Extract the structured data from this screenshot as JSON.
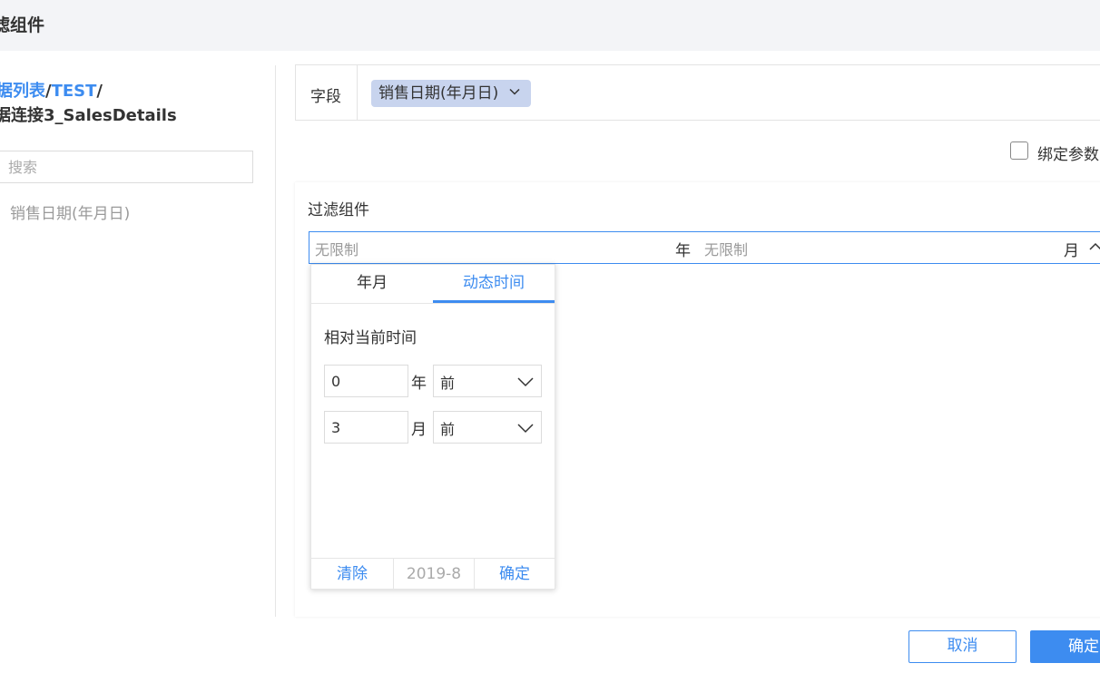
{
  "header": {
    "title": "滤组件"
  },
  "left_pane": {
    "breadcrumb": {
      "part1": "据列表",
      "sep1": "/",
      "part2": "TEST",
      "sep2": "/",
      "line2": "据连接3_SalesDetails"
    },
    "search": {
      "placeholder": "搜索",
      "value": ""
    },
    "fields": [
      "销售日期(年月日)"
    ]
  },
  "field_row": {
    "label": "字段",
    "tag": "销售日期(年月日)"
  },
  "bind_param": {
    "label": "绑定参数",
    "checked": false
  },
  "preview": {
    "title": "过滤组件",
    "range": {
      "start_placeholder": "无限制",
      "start_unit": "年",
      "end_placeholder": "无限制",
      "end_unit": "月"
    }
  },
  "picker": {
    "tabs": [
      {
        "label": "年月",
        "active": false
      },
      {
        "label": "动态时间",
        "active": true
      }
    ],
    "relative_label": "相对当前时间",
    "rows": [
      {
        "value": "0",
        "unit": "年",
        "direction": "前"
      },
      {
        "value": "3",
        "unit": "月",
        "direction": "前"
      }
    ],
    "footer": {
      "clear": "清除",
      "date": "2019-8",
      "ok": "确定"
    }
  },
  "buttons": {
    "cancel": "取消",
    "confirm": "确定"
  },
  "colors": {
    "accent": "#3d8cf0",
    "tag_bg": "#c8d4ee",
    "header_bg": "#f3f4f7"
  }
}
